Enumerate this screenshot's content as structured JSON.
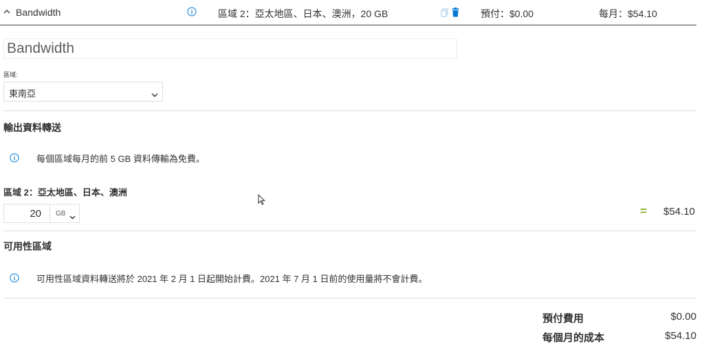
{
  "header": {
    "service_name": "Bandwidth",
    "summary": "區域 2：亞太地區、日本、澳洲，20 GB",
    "upfront": "預付：$0.00",
    "monthly": "每月：$54.10"
  },
  "name_input": {
    "value": "Bandwidth"
  },
  "region": {
    "label": "區域:",
    "selected": "東南亞"
  },
  "outbound": {
    "title": "輸出資料轉送",
    "note": "每個區域每月的前 5 GB 資料傳輸為免費。",
    "zone_label": "區域 2：亞太地區、日本、澳洲",
    "quantity": "20",
    "unit": "GB",
    "equals": "=",
    "price": "$54.10"
  },
  "availability_zone": {
    "title": "可用性區域",
    "note": "可用性區域資料轉送將於 2021 年 2 月 1 日起開始計費。2021 年 7 月 1 日前的使用量將不會計費。"
  },
  "totals": {
    "upfront_label": "預付費用",
    "upfront_value": "$0.00",
    "monthly_label": "每個月的成本",
    "monthly_value": "$54.10"
  },
  "colors": {
    "accent_blue": "#0078d4",
    "equals_green": "#8db02f",
    "divider": "#e1dfdd"
  }
}
